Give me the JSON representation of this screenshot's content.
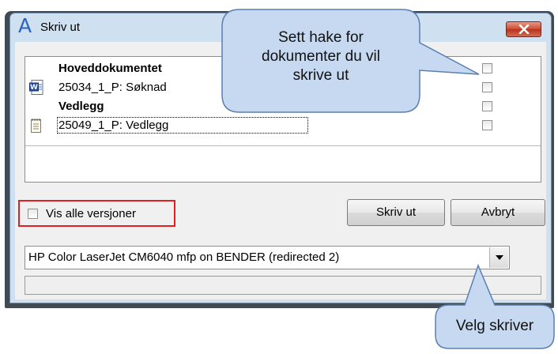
{
  "window": {
    "title": "Skriv ut"
  },
  "document_list": {
    "rows": [
      {
        "label": "Hoveddokumentet",
        "bold": true,
        "icon": "none",
        "checked": false
      },
      {
        "label": "25034_1_P: Søknad",
        "bold": false,
        "icon": "word-document-icon",
        "checked": false
      },
      {
        "label": "Vedlegg",
        "bold": true,
        "icon": "none",
        "checked": false
      },
      {
        "label": "25049_1_P: Vedlegg",
        "bold": false,
        "icon": "notepad-document-icon",
        "checked": false
      }
    ]
  },
  "options": {
    "show_all_versions_label": "Vis alle versjoner",
    "show_all_versions_checked": false
  },
  "buttons": {
    "print_label": "Skriv ut",
    "cancel_label": "Avbryt"
  },
  "printer": {
    "selected": "HP Color LaserJet CM6040 mfp on BENDER (redirected 2)"
  },
  "callouts": {
    "checkbox_hint": [
      "Sett hake for",
      "dokumenter du vil",
      "skrive ut"
    ],
    "printer_hint": "Velg skriver"
  },
  "colors": {
    "title_bar": "#cfe0f0",
    "close_button": "#c8432d",
    "highlight_border": "#e02020",
    "callout_fill": "#c6d9f1",
    "callout_border": "#5a7fb1"
  }
}
